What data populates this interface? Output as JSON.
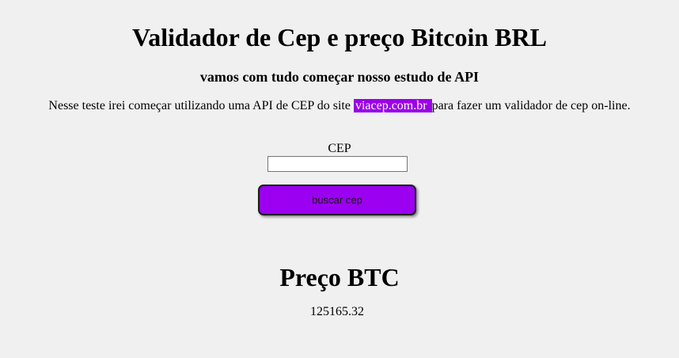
{
  "header": {
    "title": "Validador de Cep e preço Bitcoin BRL",
    "subtitle": "vamos com tudo começar nosso estudo de API"
  },
  "intro": {
    "text_before": "Nesse teste irei começar utilizando uma API de CEP do site ",
    "link_text": "viacep.com.br ",
    "text_after": "para fazer um validador de cep on-line."
  },
  "cep_form": {
    "label": "CEP",
    "input_value": "",
    "button_label": "buscar cep"
  },
  "btc": {
    "title": "Preço BTC",
    "value": "125165.32"
  },
  "colors": {
    "background": "#f0f0f0",
    "accent": "#9b00f0",
    "link_background": "#9b00e8",
    "link_text": "#ffffff"
  }
}
